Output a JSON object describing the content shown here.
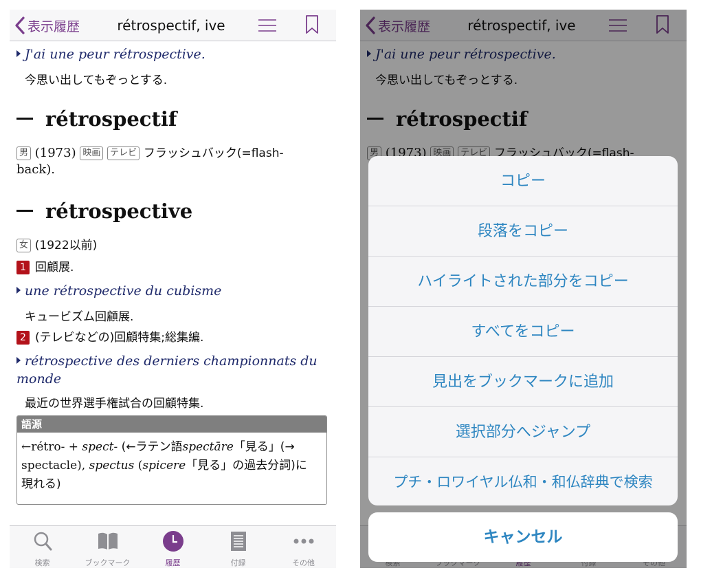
{
  "nav": {
    "back_label": "表示履歴",
    "title": "rétrospectif, ive"
  },
  "content": {
    "example_top": "J'ai une peur rétrospective.",
    "example_top_tr": "今思い出してもぞっとする.",
    "headword1": "rétrospectif",
    "hw1_tag_gender": "男",
    "hw1_year": "(1973)",
    "hw1_tag_field1": "映画",
    "hw1_tag_field2": "テレビ",
    "hw1_def_line1": "フラッシュバック(=flash-",
    "hw1_def_line2": "back).",
    "headword2": "rétrospective",
    "hw2_tag_gender": "女",
    "hw2_year": "(1922以前)",
    "sense1_num": "1",
    "sense1_def": "回顧展.",
    "sense1_ex": "une rétrospective du cubisme",
    "sense1_ex_tr": "キュービズム回顧展.",
    "sense2_num": "2",
    "sense2_def": "(テレビなどの)回顧特集;総集編.",
    "sense2_ex_line1": "rétrospective des derniers championnats du",
    "sense2_ex_line2": "monde",
    "sense2_ex_tr": "最近の世界選手権試合の回顧特集.",
    "etymology": {
      "label": "語源",
      "line1_a": "←rétro- + ",
      "line1_b": "spect-",
      "line1_c": " (←ラテン語",
      "line1_d": "spectāre",
      "line1_e": "「見る」(→",
      "line2_a": "spectacle), ",
      "line2_b": "spectus",
      "line2_c": " (",
      "line2_d": "spicere",
      "line2_e": "「見る」の過去分詞)に",
      "line3": "現れる)"
    }
  },
  "tabs": [
    {
      "label": "検索",
      "icon": "search-icon"
    },
    {
      "label": "ブックマーク",
      "icon": "book-icon"
    },
    {
      "label": "履歴",
      "icon": "clock-icon",
      "active": true
    },
    {
      "label": "付録",
      "icon": "document-icon"
    },
    {
      "label": "その他",
      "icon": "more-icon"
    }
  ],
  "action_sheet": {
    "items": [
      "コピー",
      "段落をコピー",
      "ハイライトされた部分をコピー",
      "すべてをコピー",
      "見出をブックマークに追加",
      "選択部分へジャンプ",
      "プチ・ロワイヤル仏和・和仏辞典で検索"
    ],
    "cancel": "キャンセル"
  },
  "colors": {
    "accent_purple": "#7a3d8c",
    "example_navy": "#1f2a6b",
    "sense_red": "#b3121a",
    "action_blue": "#2e86c1"
  }
}
